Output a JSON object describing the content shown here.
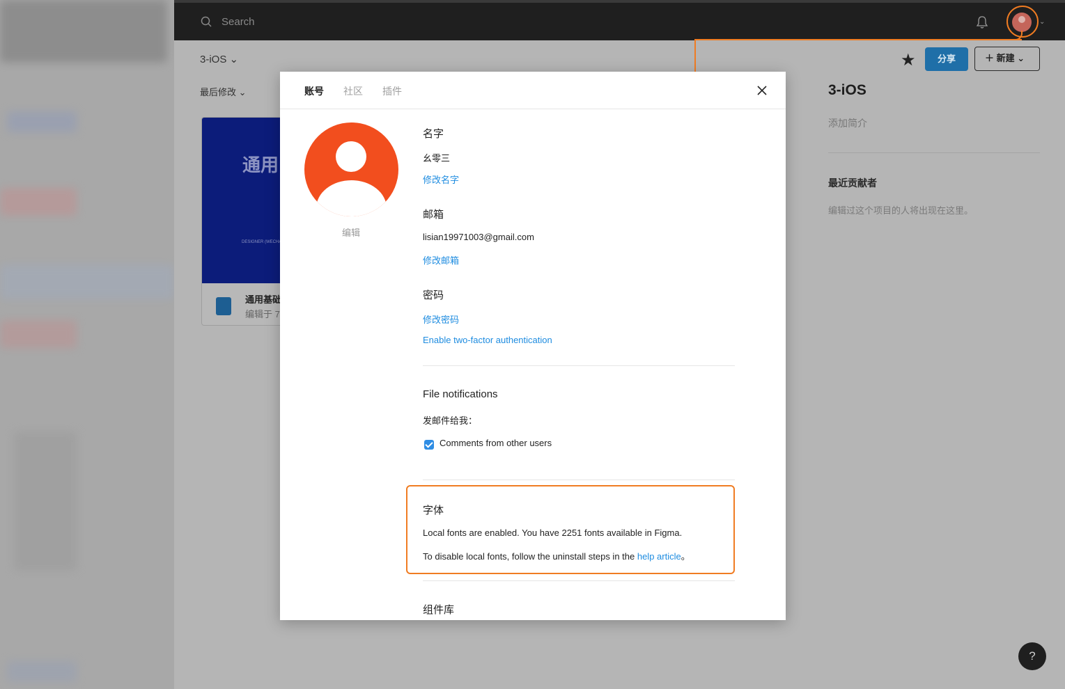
{
  "topbar": {
    "search_placeholder": "Search"
  },
  "project": {
    "title": "3-iOS ⌄",
    "sort_label": "最后修改 ⌄",
    "share_label": "分享",
    "new_label": "＋ 新建 ⌄"
  },
  "card": {
    "thumb_title": "通用",
    "thumb_sub": "DESIGNER (WECHA",
    "name": "通用基础",
    "meta": "编辑于 7"
  },
  "side_panel": {
    "title": "3-iOS",
    "description_placeholder": "添加简介",
    "contributors_heading": "最近贡献者",
    "contributors_empty": "编辑过这个项目的人将出现在这里。"
  },
  "help": {
    "label": "?"
  },
  "modal": {
    "tabs": [
      {
        "label": "账号"
      },
      {
        "label": "社区"
      },
      {
        "label": "插件"
      }
    ],
    "avatar_edit": "编辑",
    "name": {
      "heading": "名字",
      "value": "幺零三",
      "action": "修改名字"
    },
    "email": {
      "heading": "邮箱",
      "value": "lisian19971003@gmail.com",
      "action": "修改邮箱"
    },
    "password": {
      "heading": "密码",
      "action": "修改密码",
      "two_factor": "Enable two-factor authentication"
    },
    "notifications": {
      "heading": "File notifications",
      "email_me": "发邮件给我：",
      "comments_option": "Comments from other users",
      "comments_checked": true
    },
    "fonts": {
      "heading": "字体",
      "status": "Local fonts are enabled. You have 2251 fonts available in Figma.",
      "disable_prefix": "To disable local fonts, follow the uninstall steps in the ",
      "help_link": "help article",
      "disable_suffix": "。"
    },
    "library": {
      "heading": "组件库"
    }
  },
  "colors": {
    "accent_blue": "#1e8ce0",
    "avatar_orange": "#f24e1e",
    "annotation_orange": "#f07c22"
  }
}
